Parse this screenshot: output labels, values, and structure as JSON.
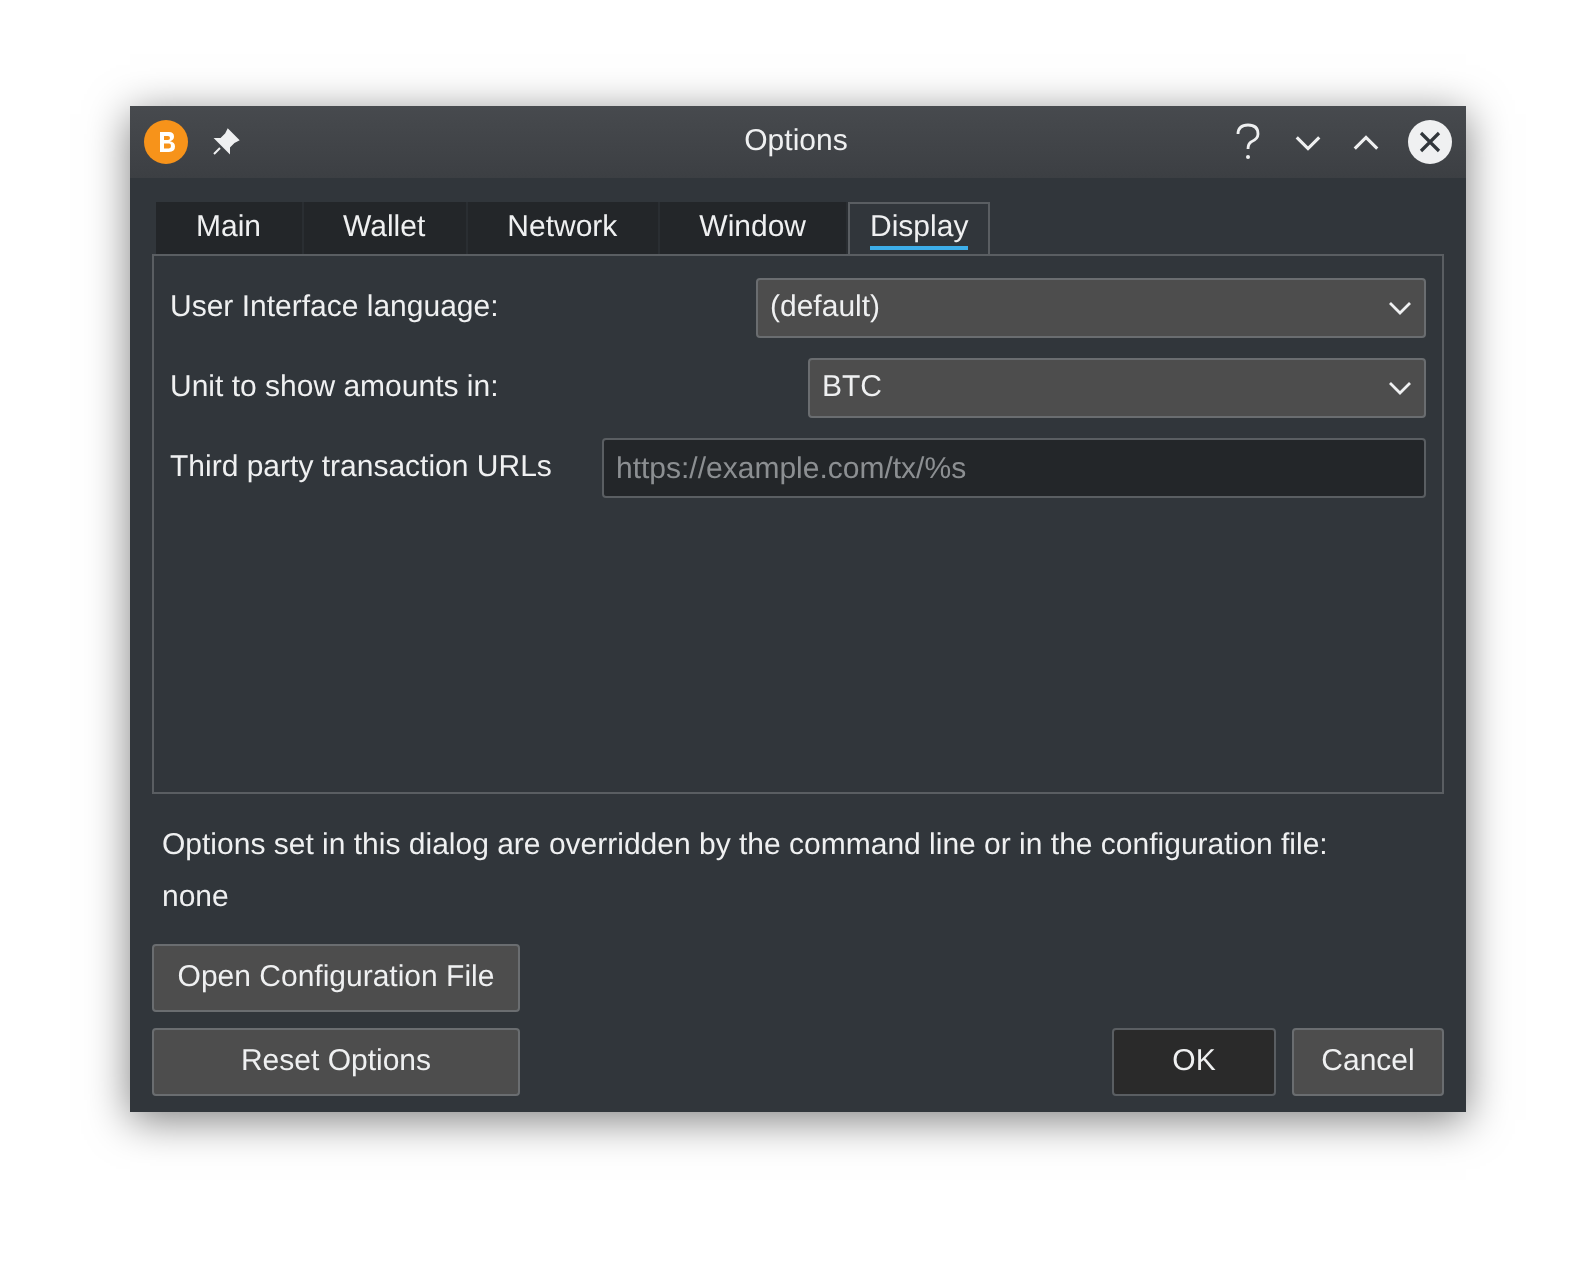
{
  "window": {
    "title": "Options"
  },
  "tabs": [
    {
      "label": "Main",
      "selected": false
    },
    {
      "label": "Wallet",
      "selected": false
    },
    {
      "label": "Network",
      "selected": false
    },
    {
      "label": "Window",
      "selected": false
    },
    {
      "label": "Display",
      "selected": true
    }
  ],
  "settings": [
    {
      "kind": "combo",
      "label": "User Interface language:",
      "value": "(default)"
    },
    {
      "kind": "combo",
      "label": "Unit to show amounts in:",
      "value": "BTC"
    },
    {
      "kind": "text",
      "label": "Third party transaction URLs",
      "placeholder": "https://example.com/tx/%s"
    }
  ],
  "override_note": "Options set in this dialog are overridden by the command line or in the configuration file:",
  "override_value": "none",
  "open_config_button": "Open Configuration File",
  "reset_button": "Reset Options",
  "buttons": [
    {
      "label": "OK",
      "default": true
    },
    {
      "label": "Cancel",
      "default": false
    }
  ]
}
